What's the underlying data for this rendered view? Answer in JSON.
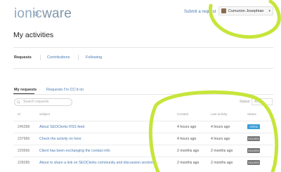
{
  "header": {
    "logo_part1": "ionic",
    "logo_part2": "ware",
    "submit_request": "Submit a request",
    "user_name": "Cumurion Josephian",
    "user_caret": "▾"
  },
  "page": {
    "title": "My activities"
  },
  "tabs": [
    {
      "label": "Requests"
    },
    {
      "label": "Contributions"
    },
    {
      "label": "Following"
    }
  ],
  "subtabs": {
    "my_requests": "My requests",
    "cc_requests": "Requests I'm CC'd on"
  },
  "search": {
    "placeholder": "Search requests"
  },
  "filter": {
    "status_label": "Status:",
    "status_value": "Any"
  },
  "table": {
    "headers": {
      "id": "Id",
      "subject": "Subject",
      "created": "Created",
      "last": "Last activity",
      "status": "Status"
    },
    "rows": [
      {
        "id": "246398",
        "subject": "About SEOClerks RSS feed",
        "created": "4 hours ago",
        "last": "4 hours ago",
        "status": "OPEN"
      },
      {
        "id": "237966",
        "subject": "Check the activity on here",
        "created": "4 hours ago",
        "last": "4 hours ago",
        "status": "SOLVED"
      },
      {
        "id": "229566",
        "subject": "Client has been exchanging the contact info",
        "created": "2 months ago",
        "last": "2 months ago",
        "status": "SOLVED"
      },
      {
        "id": "228285",
        "subject": "About to share a link on SEOClerks community and discussion section",
        "created": "2 months ago",
        "last": "2 months ago",
        "status": "SOLVED"
      }
    ]
  },
  "colors": {
    "annotation": "#c6e53a",
    "open": "#3a9fd8",
    "solved": "#777777",
    "link": "#4a7ab0"
  }
}
